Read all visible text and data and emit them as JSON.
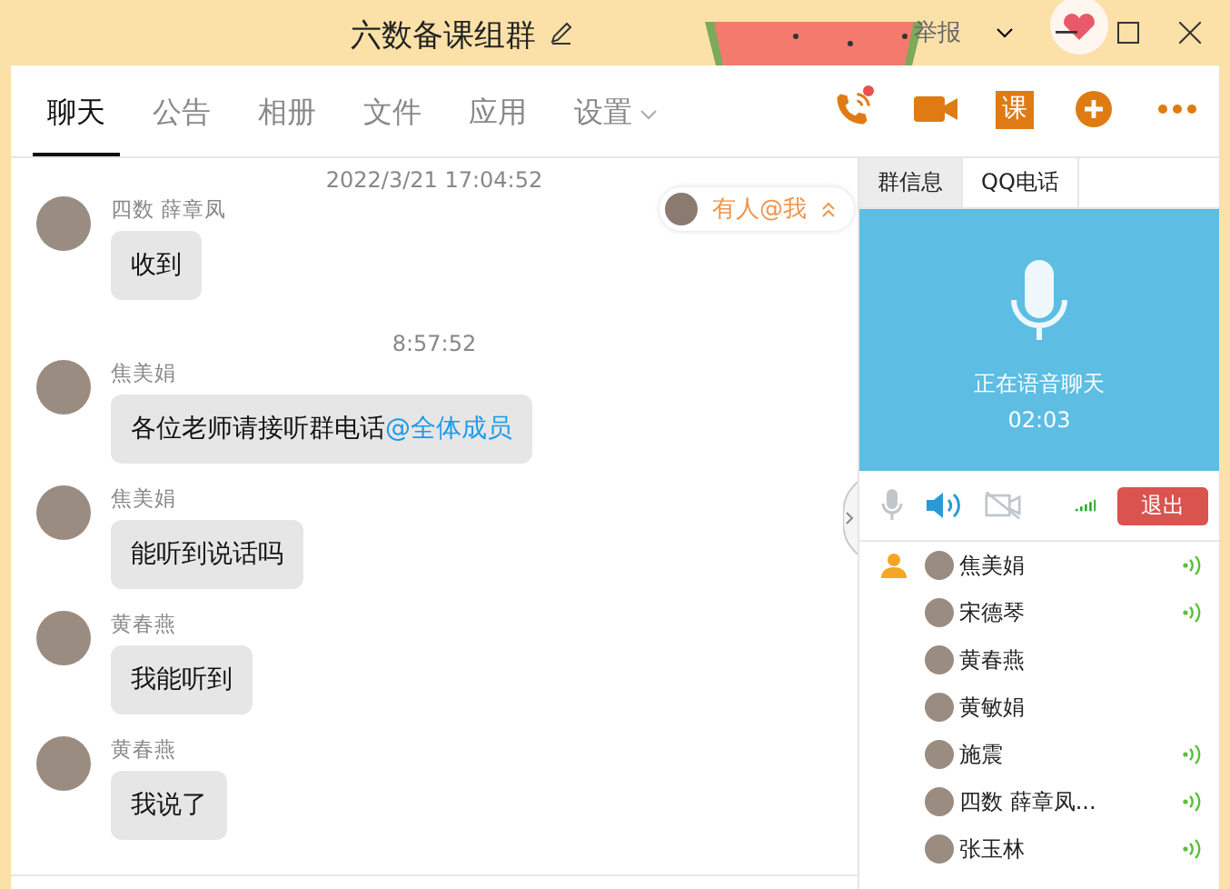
{
  "window": {
    "title": "六数备课组群",
    "report": "举报"
  },
  "tabs": [
    {
      "label": "聊天",
      "selected": true,
      "dropdown": false
    },
    {
      "label": "公告",
      "selected": false,
      "dropdown": false
    },
    {
      "label": "相册",
      "selected": false,
      "dropdown": false
    },
    {
      "label": "文件",
      "selected": false,
      "dropdown": false
    },
    {
      "label": "应用",
      "selected": false,
      "dropdown": false
    },
    {
      "label": "设置",
      "selected": false,
      "dropdown": true
    }
  ],
  "toolbar": [
    {
      "kind": "phone",
      "badge": true
    },
    {
      "kind": "video"
    },
    {
      "kind": "lesson",
      "label": "课"
    },
    {
      "kind": "plus"
    },
    {
      "kind": "more"
    }
  ],
  "messages": [
    {
      "kind": "time",
      "text": "2022/3/21 17:04:52"
    },
    {
      "kind": "message",
      "sender": "四数 薛章凤",
      "text": "收到"
    },
    {
      "kind": "time",
      "text": "8:57:52"
    },
    {
      "kind": "message",
      "sender": "焦美娟",
      "text": "各位老师请接听群电话",
      "mention": "@全体成员"
    },
    {
      "kind": "message",
      "sender": "焦美娟",
      "text": "能听到说话吗"
    },
    {
      "kind": "message",
      "sender": "黄春燕",
      "text": "我能听到"
    },
    {
      "kind": "message",
      "sender": "黄春燕",
      "text": "我说了"
    }
  ],
  "mention_notice": {
    "text": "有人@我"
  },
  "side_tabs": [
    {
      "label": "群信息",
      "selected": false
    },
    {
      "label": "QQ电话",
      "selected": true
    }
  ],
  "call": {
    "status": "正在语音聊天",
    "duration": "02:03",
    "mic_on": false,
    "speaker_on": true,
    "camera_on": false,
    "leave": "退出"
  },
  "members": [
    {
      "name": "焦美娟",
      "host": true,
      "speaking": true
    },
    {
      "name": "宋德琴",
      "host": false,
      "speaking": true
    },
    {
      "name": "黄春燕",
      "host": false,
      "speaking": false
    },
    {
      "name": "黄敏娟",
      "host": false,
      "speaking": false
    },
    {
      "name": "施震",
      "host": false,
      "speaking": true
    },
    {
      "name": "四数 薛章凤...",
      "host": false,
      "speaking": true
    },
    {
      "name": "张玉林",
      "host": false,
      "speaking": true
    }
  ]
}
